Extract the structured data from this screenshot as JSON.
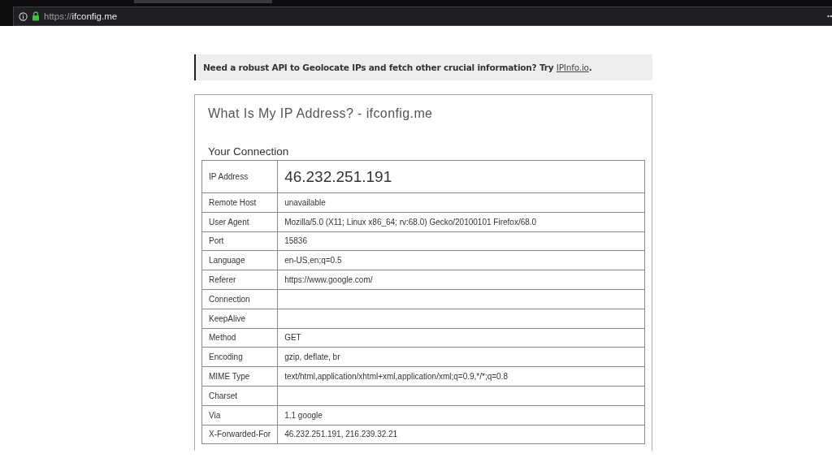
{
  "browser": {
    "url_scheme": "https://",
    "url_host": "ifconfig.me",
    "secure": true
  },
  "banner": {
    "text": "Need a robust API to Geolocate IPs and fetch other crucial information? Try ",
    "link": "IPInfo.io",
    "tail": "."
  },
  "page": {
    "title": "What Is My IP Address? - ifconfig.me",
    "section": "Your Connection"
  },
  "rows": [
    {
      "label": "IP Address",
      "value": "46.232.251.191",
      "kind": "headline"
    },
    {
      "label": "Remote Host",
      "value": "unavailable",
      "kind": "plain"
    },
    {
      "label": "User Agent",
      "value": "Mozilla/5.0 (X11; Linux x86_64; rv:68.0) Gecko/20100101 Firefox/68.0",
      "kind": "plain"
    },
    {
      "label": "Port",
      "value": "15836",
      "kind": "plain"
    },
    {
      "label": "Language",
      "value": "en-US,en;q=0.5",
      "kind": "plain"
    },
    {
      "label": "Referer",
      "value": "https://www.google.com/",
      "kind": "plain"
    },
    {
      "label": "Connection",
      "kind": "plain"
    },
    {
      "label": "KeepAlive",
      "kind": "plain"
    },
    {
      "label": "Method",
      "value": "GET",
      "kind": "plain"
    },
    {
      "label": "Encoding",
      "value": "gzip, deflate, br",
      "kind": "plain"
    },
    {
      "label": "MIME Type",
      "value": "text/html,application/xhtml+xml,application/xml;q=0.9,*/*;q=0.8",
      "kind": "plain"
    },
    {
      "label": "Charset",
      "kind": "plain"
    },
    {
      "label": "Via",
      "value": "1.1 google",
      "kind": "plain"
    },
    {
      "label": "X-Forwarded-For",
      "value": "46.232.251.191, 216.239.32.21",
      "kind": "plain"
    }
  ]
}
